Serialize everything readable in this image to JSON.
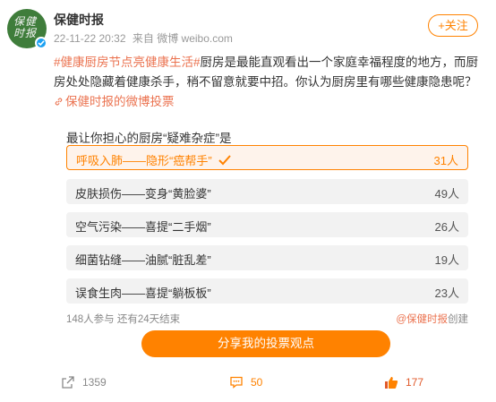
{
  "account": {
    "username": "保健时报",
    "avatar_text": "保健\n时报",
    "follow_label": "+关注"
  },
  "meta": {
    "timestamp": "22-11-22 20:32",
    "source": "来自 微博 weibo.com"
  },
  "post": {
    "hashtag": "#健康厨房节点亮健康生活#",
    "text": "厨房是最能直观看出一个家庭幸福程度的地方，而厨房处处隐藏着健康杀手，稍不留意就要中招。你认为厨房里有哪些健康隐患呢？",
    "link": "保健时报的微博投票"
  },
  "poll": {
    "title": "最让你担心的厨房“疑难杂症”是",
    "options": [
      {
        "label": "呼吸入肺——隐形“癌帮手”",
        "count": "31人",
        "selected": true
      },
      {
        "label": "皮肤损伤——变身“黄脸婆”",
        "count": "49人",
        "selected": false
      },
      {
        "label": "空气污染——喜提“二手烟”",
        "count": "26人",
        "selected": false
      },
      {
        "label": "细菌钻缝——油腻“脏乱差”",
        "count": "19人",
        "selected": false
      },
      {
        "label": "误食生肉——喜提“躺板板”",
        "count": "23人",
        "selected": false
      }
    ],
    "footer_left": "148人参与 还有24天结束",
    "creator": "@保健时报",
    "creator_suffix": "创建",
    "share_label": "分享我的投票观点"
  },
  "actions": {
    "repost_count": "1359",
    "comment_count": "50",
    "like_count": "177"
  },
  "colors": {
    "accent": "#ff8200",
    "hashtag": "#eb7350",
    "avatar_bg": "#3f7d3b",
    "verified": "#1da1f2"
  }
}
